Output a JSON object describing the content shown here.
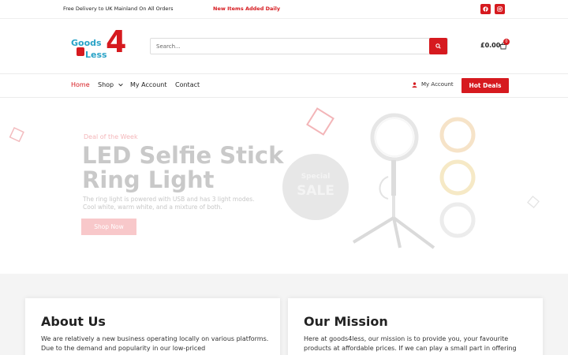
{
  "topbar": {
    "delivery": "Free Delivery to UK Mainland On All Orders",
    "promo": "New Items Added Daily",
    "social": [
      "facebook-icon",
      "instagram-icon"
    ]
  },
  "header": {
    "logo": {
      "goods": "Goods",
      "four": "4",
      "less": "Less"
    },
    "search_placeholder": "Search...",
    "cart_total": "£0.00",
    "cart_count": "0"
  },
  "nav": {
    "items": [
      {
        "label": "Home",
        "active": true
      },
      {
        "label": "Shop"
      },
      {
        "label": "My Account"
      },
      {
        "label": "Contact"
      }
    ],
    "account_label": "My Account",
    "hot_deals": "Hot Deals"
  },
  "hero": {
    "kicker": "Deal of the Week",
    "title": "LED Selfie Stick Ring Light",
    "description": "The ring light is powered with USB and has 3 light modes. Cool white, warm white, and a mixture of both.",
    "button": "Shop Now",
    "badge_line1": "Special",
    "badge_line2": "SALE"
  },
  "about": {
    "title": "About Us",
    "text": "We are relatively a new business operating locally on various platforms. Due to the demand and popularity in our low-priced"
  },
  "mission": {
    "title": "Our Mission",
    "text": "Here at goods4less, our mission is to provide you, your favourite products at affordable prices. If we can play a small part in offering"
  },
  "colors": {
    "brand_red": "#d61a1f",
    "logo_blue": "#2aa3c7"
  }
}
